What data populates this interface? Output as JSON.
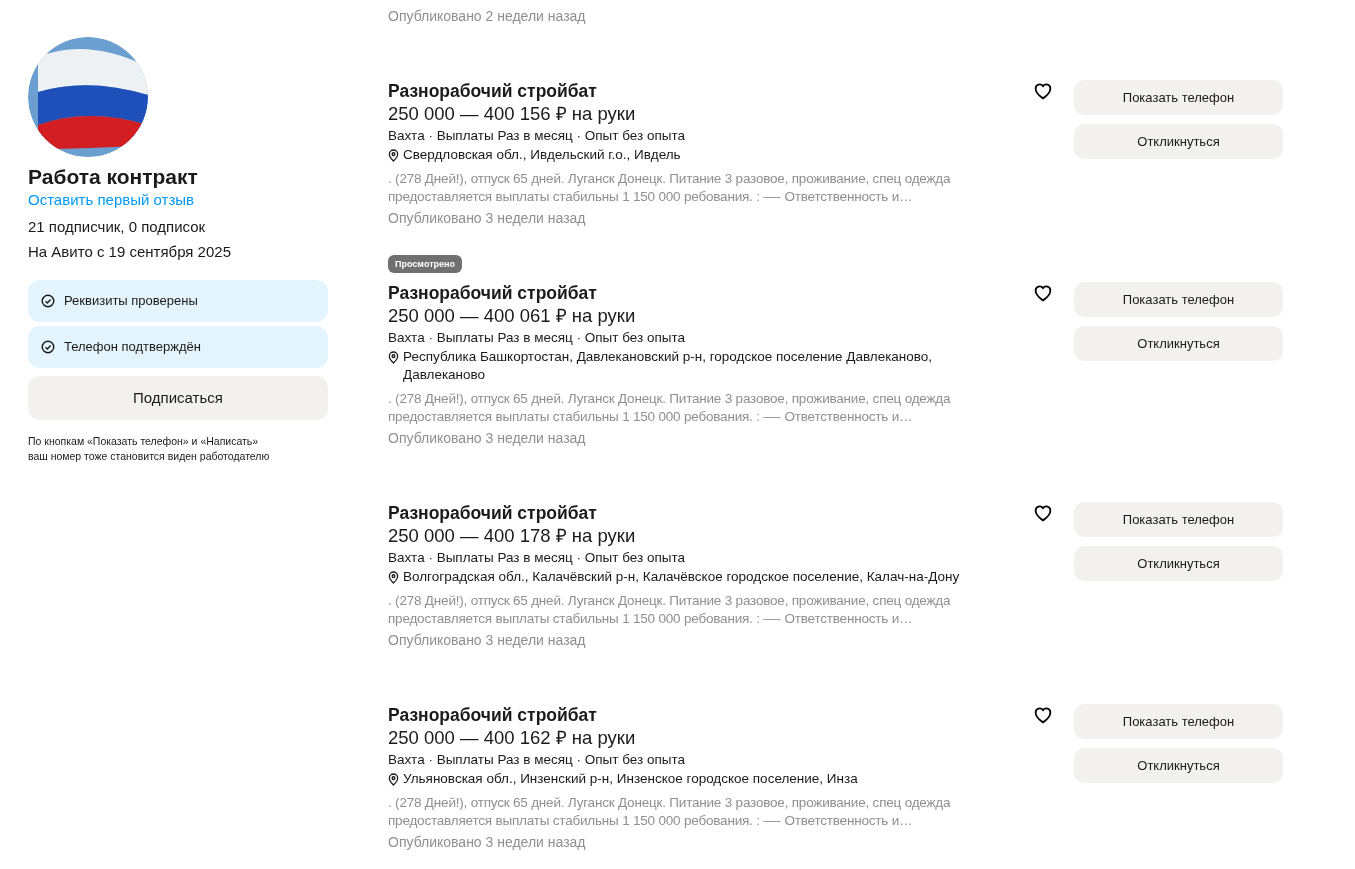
{
  "profile": {
    "name": "Работа контракт",
    "review_link": "Оставить первый отзыв",
    "followers": "21 подписчик, 0 подписок",
    "since": "На Авито с 19 сентября 2025",
    "verifications": [
      "Реквизиты проверены",
      "Телефон подтверждён"
    ],
    "subscribe_button": "Подписаться",
    "note": "По кнопкам «Показать телефон» и «Написать»\nваш номер тоже становится виден работодателю"
  },
  "previous_listing": {
    "published": "Опубликовано 2 недели назад"
  },
  "listings": [
    {
      "viewed": false,
      "title": "Разнорабочий стройбат",
      "salary": "250 000 — 400 156 ₽ на руки",
      "meta": "Вахта · Выплаты Раз в месяц · Опыт без опыта",
      "location": "Свердловская обл., Ивдельский г.о., Ивдель",
      "description": ". (278 Дней!), отпуск 65 дней. Луганск Донецк. Питание 3 разовое, проживание, спец одежда\nпредоставляется выплаты стабильны 1 150 000 ребования. : —- Ответственность и…",
      "published": "Опубликовано 3 недели назад",
      "favorite": false,
      "phone_button": "Показать телефон",
      "respond_button": "Откликнуться"
    },
    {
      "viewed": true,
      "badge": "Просмотрено",
      "title": "Разнорабочий стройбат",
      "salary": "250 000 — 400 061 ₽ на руки",
      "meta": "Вахта · Выплаты Раз в месяц · Опыт без опыта",
      "location": "Республика Башкортостан, Давлекановский р-н, городское поселение Давлеканово,\nДавлеканово",
      "description": ". (278 Дней!), отпуск 65 дней. Луганск Донецк. Питание 3 разовое, проживание, спец одежда\nпредоставляется выплаты стабильны 1 150 000 ребования. : —- Ответственность и…",
      "published": "Опубликовано 3 недели назад",
      "favorite": false,
      "phone_button": "Показать телефон",
      "respond_button": "Откликнуться"
    },
    {
      "viewed": false,
      "title": "Разнорабочий стройбат",
      "salary": "250 000 — 400 178 ₽ на руки",
      "meta": "Вахта · Выплаты Раз в месяц · Опыт без опыта",
      "location": "Волгоградская обл., Калачёвский р-н, Калачёвское городское поселение, Калач-на-Дону",
      "description": ". (278 Дней!), отпуск 65 дней. Луганск Донецк. Питание 3 разовое, проживание, спец одежда\nпредоставляется выплаты стабильны 1 150 000 ребования. : —- Ответственность и…",
      "published": "Опубликовано 3 недели назад",
      "favorite": false,
      "phone_button": "Показать телефон",
      "respond_button": "Откликнуться"
    },
    {
      "viewed": false,
      "title": "Разнорабочий стройбат",
      "salary": "250 000 — 400 162 ₽ на руки",
      "meta": "Вахта · Выплаты Раз в месяц · Опыт без опыта",
      "location": "Ульяновская обл., Инзенский р-н, Инзенское городское поселение, Инза",
      "description": ". (278 Дней!), отпуск 65 дней. Луганск Донецк. Питание 3 разовое, проживание, спец одежда\nпредоставляется выплаты стабильны 1 150 000 ребования. : —- Ответственность и…",
      "published": "Опубликовано 3 недели назад",
      "favorite": false,
      "phone_button": "Показать телефон",
      "respond_button": "Откликнуться"
    }
  ]
}
